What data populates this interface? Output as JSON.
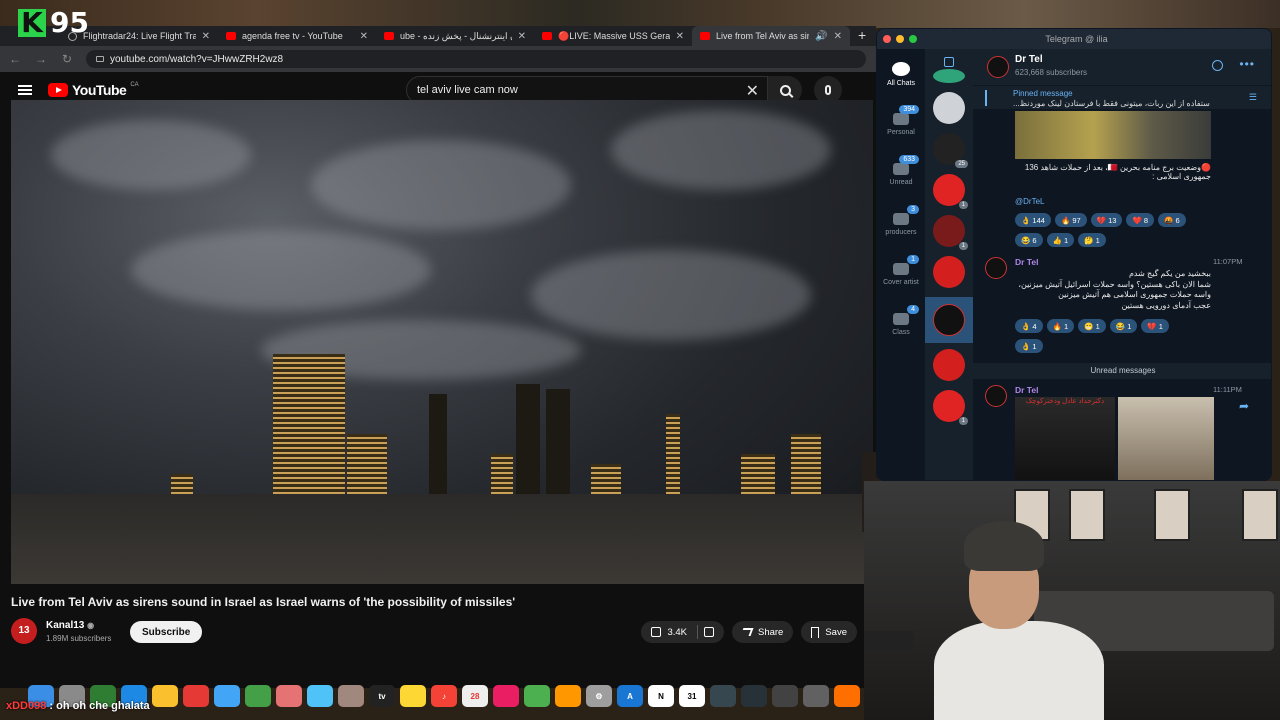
{
  "stream": {
    "logo_letter": "K",
    "logo_number": "95"
  },
  "browser": {
    "tabs": [
      {
        "label": "Flightradar24: Live Flight Tra",
        "active": false
      },
      {
        "label": "agenda free tv - YouTube",
        "active": false
      },
      {
        "label": "ube - ایران اینترنشنال - پخش زنده",
        "active": false
      },
      {
        "label": "🔴LIVE: Massive USS Gerald",
        "active": false
      },
      {
        "label": "Live from Tel Aviv as siren",
        "active": true
      }
    ],
    "url": "youtube.com/watch?v=JHwwZRH2wz8"
  },
  "youtube": {
    "logo": "YouTube",
    "country": "CA",
    "search_value": "tel aviv live cam now",
    "video_title": "Live from Tel Aviv as sirens sound in Israel as Israel warns of 'the possibility of missiles'",
    "channel": {
      "name": "Kanal13",
      "subscribers": "1.89M subscribers",
      "avatar_text": "13"
    },
    "subscribe_label": "Subscribe",
    "likes": "3.4K",
    "share_label": "Share",
    "save_label": "Save"
  },
  "telegram": {
    "window_title": "Telegram @ ilia",
    "folders": [
      {
        "label": "All Chats",
        "badge": ""
      },
      {
        "label": "Personal",
        "badge": "394"
      },
      {
        "label": "Unread",
        "badge": "633"
      },
      {
        "label": "producers",
        "badge": "3"
      },
      {
        "label": "Cover artist",
        "badge": "1"
      },
      {
        "label": "Class",
        "badge": "4"
      }
    ],
    "chat_counts": [
      "25",
      "1",
      "1",
      "1",
      "1"
    ],
    "channel_name": "Dr Tel",
    "channel_subs": "623,668 subscribers",
    "pinned_title": "Pinned message",
    "pinned_text": "ستفاده از این ربات، میتونی فقط با فرستادن لینک موردنظ...",
    "msg1_text": "🔴وضعیت برج منامه بحرین 🇧🇭، بعد از حملات شاهد 136 جمهوری اسلامی :",
    "msg1_link": "@DrTeL",
    "msg1_reacts": [
      "👌 144",
      "🔥 97",
      "💔 13",
      "❤️ 8",
      "🤬 6",
      "😂 6",
      "👍 1",
      "🤔 1"
    ],
    "msg2_author": "Dr Tel",
    "msg2_time": "11:07PM",
    "msg2_text": "ببخشید من یکم گیج شدم\nشما الان باکی هستین؟ واسه حملات اسرائیل آتیش میزنین،\nواسه حملات جمهوری اسلامی هم آتیش میزنین\nعجب آدمای دورویی هستین",
    "msg2_reacts": [
      "👌 4",
      "🔥 1",
      "😁 1",
      "😂 1",
      "💔 1",
      "👌 1"
    ],
    "unread_label": "Unread messages",
    "msg3_author": "Dr Tel",
    "msg3_time": "11:11PM",
    "msg3_photo_caption": "دکترحداد عادل ودخترکوچک"
  },
  "dock": {
    "calendar_day": "28"
  },
  "chat_overlay": {
    "user": "xDD098",
    "text": ": oh oh che ghalata"
  }
}
